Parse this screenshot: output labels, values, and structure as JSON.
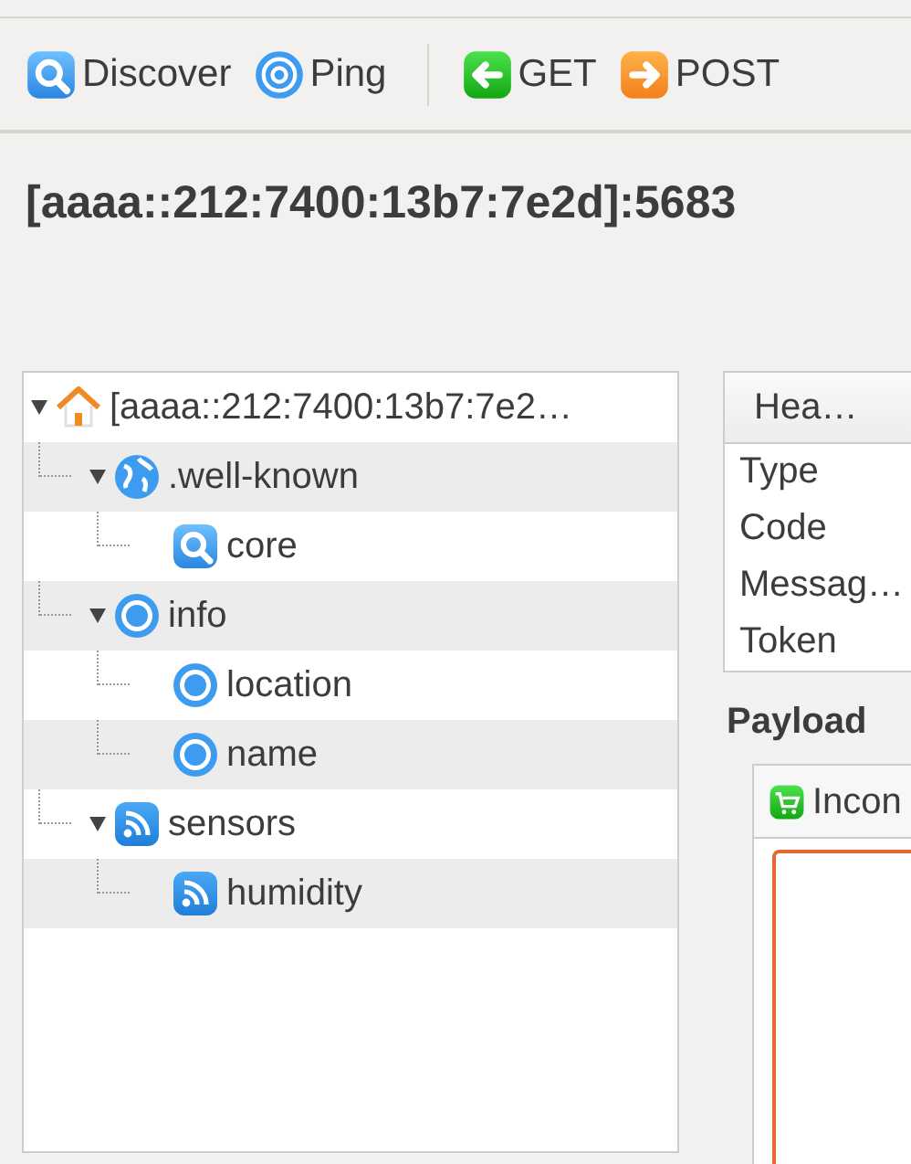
{
  "toolbar": [
    {
      "kind": "discover",
      "label": "Discover"
    },
    {
      "kind": "ping",
      "label": "Ping"
    },
    {
      "kind": "separator"
    },
    {
      "kind": "get",
      "label": "GET"
    },
    {
      "kind": "post",
      "label": "POST"
    }
  ],
  "title": "[aaaa::212:7400:13b7:7e2d]:5683",
  "tree": [
    {
      "kind": "home",
      "label": "[aaaa::212:7400:13b7:7e2…",
      "expanded": true,
      "children": [
        {
          "kind": "globe",
          "label": ".well-known",
          "expanded": true,
          "children": [
            {
              "kind": "search",
              "label": "core"
            }
          ]
        },
        {
          "kind": "circle",
          "label": "info",
          "expanded": true,
          "children": [
            {
              "kind": "circle",
              "label": "location"
            },
            {
              "kind": "circle",
              "label": "name"
            }
          ]
        },
        {
          "kind": "feed",
          "label": "sensors",
          "expanded": true,
          "children": [
            {
              "kind": "feed",
              "label": "humidity"
            }
          ]
        }
      ]
    }
  ],
  "header_table": {
    "column": "Hea…",
    "rows": [
      "Type",
      "Code",
      "Messag…",
      "Token"
    ]
  },
  "payload": {
    "label": "Payload",
    "tab": "Incon"
  }
}
